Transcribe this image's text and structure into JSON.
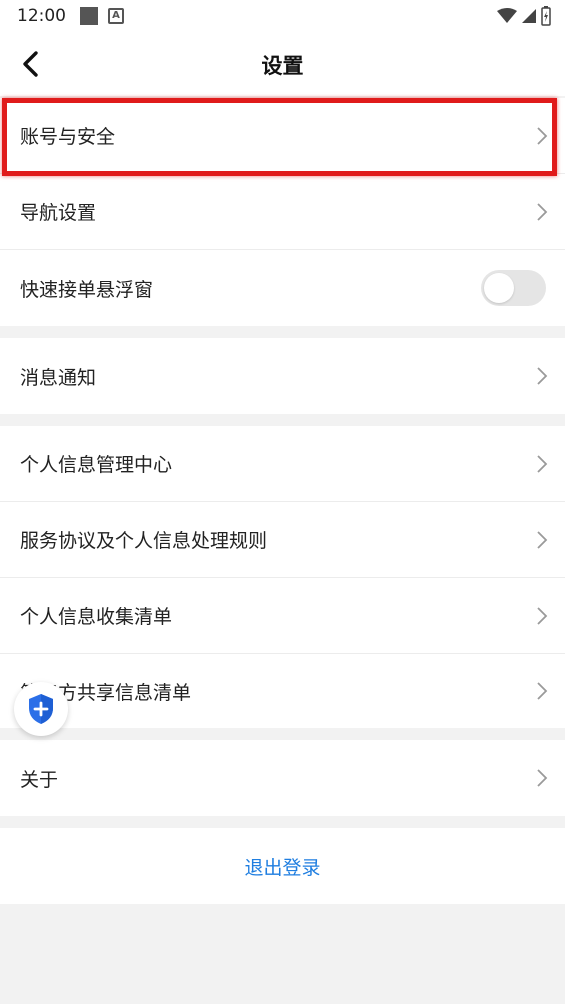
{
  "status_bar": {
    "time": "12:00"
  },
  "header": {
    "title": "设置"
  },
  "groups": [
    {
      "items": [
        {
          "label": "账号与安全"
        },
        {
          "label": "导航设置"
        },
        {
          "label": "快速接单悬浮窗",
          "toggle": false
        }
      ]
    },
    {
      "items": [
        {
          "label": "消息通知"
        }
      ]
    },
    {
      "items": [
        {
          "label": "个人信息管理中心"
        },
        {
          "label": "服务协议及个人信息处理规则"
        },
        {
          "label": "个人信息收集清单"
        },
        {
          "label": "第三方共享信息清单"
        }
      ]
    },
    {
      "items": [
        {
          "label": "关于"
        }
      ]
    }
  ],
  "logout_label": "退出登录",
  "colors": {
    "highlight": "#e01b1b",
    "link": "#1f7ee0",
    "badge": "#2b6fe8"
  }
}
